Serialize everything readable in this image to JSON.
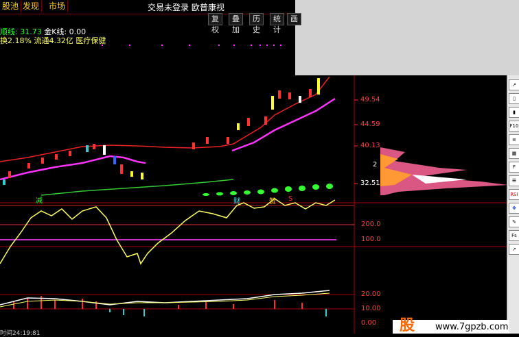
{
  "tabs": [
    {
      "label": "股池"
    },
    {
      "label": "发现"
    },
    {
      "label": "市场"
    }
  ],
  "title": "交易未登录  欧普康视",
  "toolbar": {
    "btn1": "复权",
    "btn2": "叠加",
    "btn3": "历史",
    "btn4": "统计",
    "btn5": "画"
  },
  "info": {
    "line_label": "顺线:",
    "line_value": "31.73",
    "gold_k": "金K线: 0.00",
    "turnover": "换2.18% 流通4.32亿 医疗保健"
  },
  "price_axis": [
    "49.54",
    "44.59",
    "40.13",
    "2",
    "32.51"
  ],
  "indicator1_axis": [
    "200.0",
    "100.0"
  ],
  "indicator2_axis": [
    "20.00",
    "10.00",
    "0.00"
  ],
  "markers": {
    "m1": "减",
    "m2": "财",
    "m3": "赞",
    "m4": "S"
  },
  "sidebar_icons": [
    "chart-line-icon",
    "candle-icon",
    "bar-icon",
    "fin-icon",
    "doc-icon",
    "grid-icon",
    "fin2-icon",
    "list-icon",
    "rsi-icon",
    "move-icon",
    "pen-icon",
    "fs-icon",
    "cursor-icon"
  ],
  "sidebar_labels": {
    "fin": "F10",
    "rsi": "RSI",
    "fs": "Fs"
  },
  "watermark": {
    "cn": "股",
    "url": "www.7gpzb.com"
  },
  "status_text": "时间24:19:81",
  "colors": {
    "up": "#ff3333",
    "down": "#33cccc",
    "ma_magenta": "#ff33ff",
    "ma_green": "#33cc33",
    "gold": "#ffcc00"
  }
}
